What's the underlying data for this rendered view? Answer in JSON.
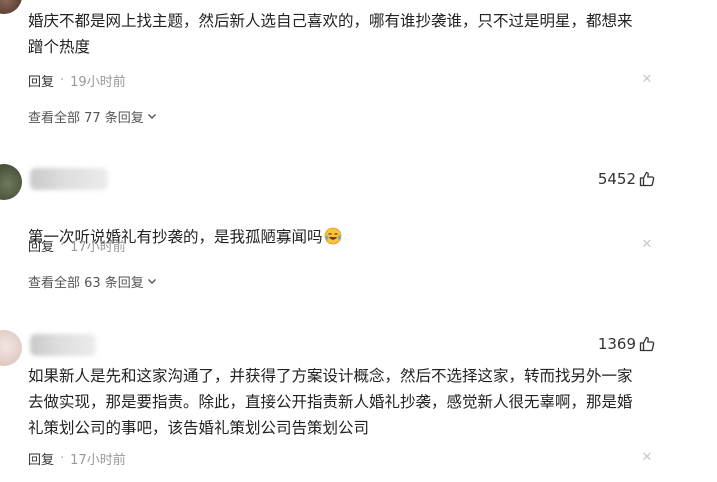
{
  "comments": [
    {
      "text": "婚庆不都是网上找主题，然后新人选自己喜欢的，哪有谁抄袭谁，只不过是明星，都想来\n蹭个热度",
      "reply_label": "回复",
      "separator": "·",
      "time": "19小时前",
      "view_all": "查看全部 77 条回复"
    },
    {
      "likes": "5452",
      "text": "第一次听说婚礼有抄袭的，是我孤陋寡闻吗",
      "emoji": "crying-laughing-emoji",
      "reply_label": "回复",
      "separator": "·",
      "time": "17小时前",
      "view_all": "查看全部 63 条回复"
    },
    {
      "likes": "1369",
      "text": "如果新人是先和这家沟通了，并获得了方案设计概念，然后不选择这家，转而找另外一家\n去做实现，那是要指责。除此，直接公开指责新人婚礼抄袭，感觉新人很无辜啊，那是婚\n礼策划公司的事吧，该告婚礼策划公司告策划公司",
      "reply_label": "回复",
      "separator": "·",
      "time": "17小时前"
    }
  ],
  "icons": {
    "close": "close-icon",
    "like": "thumbs-up-icon",
    "expand": "chevron-down-icon"
  }
}
